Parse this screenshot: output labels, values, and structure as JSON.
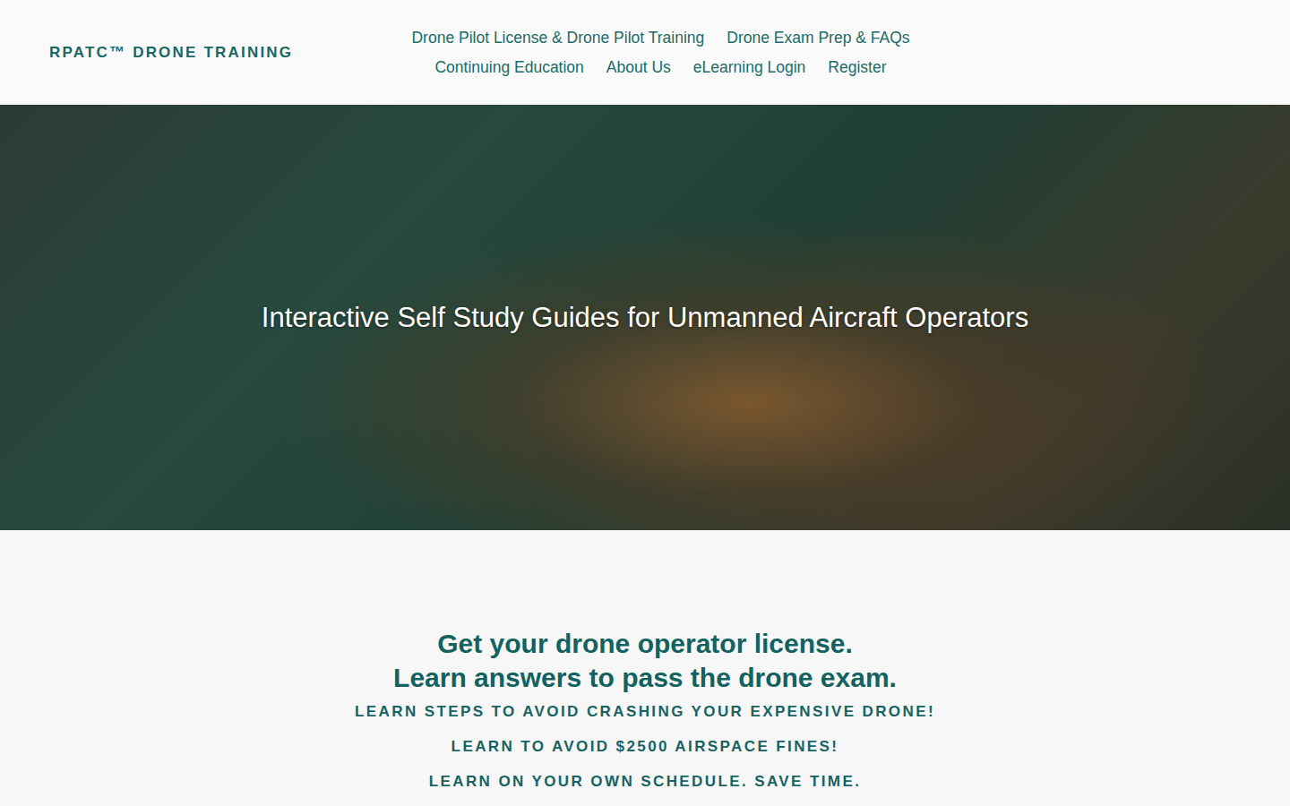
{
  "logo": {
    "text": "RPATC™ DRONE TRAINING"
  },
  "nav": [
    {
      "label": "Drone Pilot License & Drone Pilot Training"
    },
    {
      "label": "Drone Exam Prep & FAQs"
    },
    {
      "label": "Continuing Education"
    },
    {
      "label": "About Us"
    },
    {
      "label": "eLearning Login"
    },
    {
      "label": "Register"
    }
  ],
  "hero": {
    "title": "Interactive Self Study Guides for Unmanned Aircraft Operators"
  },
  "intro": {
    "headline": [
      "Get your drone operator license.",
      "Learn answers to pass the drone exam."
    ],
    "taglines": [
      "LEARN STEPS TO AVOID CRASHING YOUR EXPENSIVE DRONE!",
      "LEARN TO AVOID $2500 AIRSPACE FINES!",
      "LEARN ON YOUR OWN SCHEDULE. SAVE TIME."
    ]
  }
}
